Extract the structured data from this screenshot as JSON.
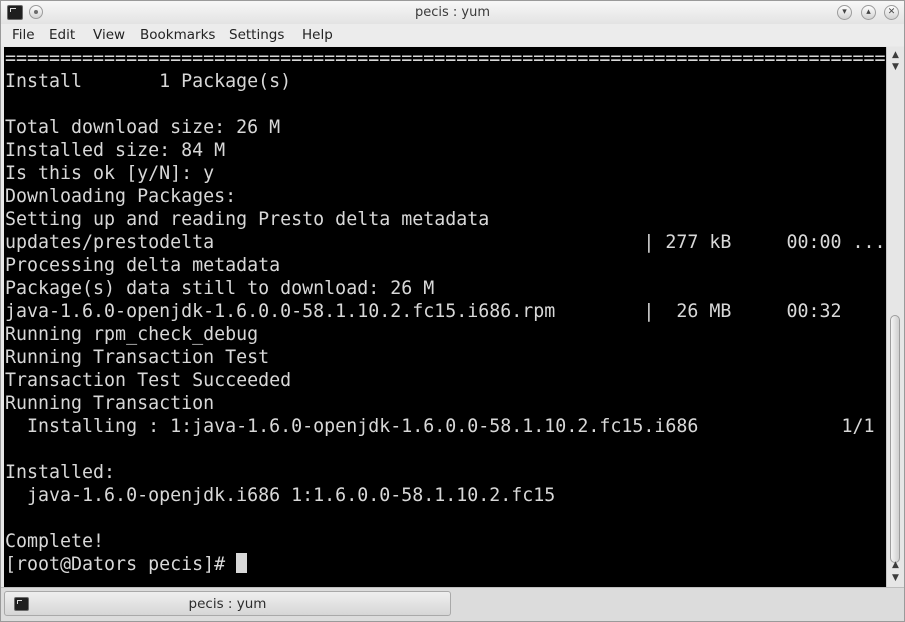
{
  "window": {
    "title": "pecis : yum"
  },
  "titlebar_buttons": {
    "minimize_glyph": "▾",
    "maximize_glyph": "▴",
    "close_glyph": "✕"
  },
  "menu": [
    "File",
    "Edit",
    "View",
    "Bookmarks",
    "Settings",
    "Help"
  ],
  "terminal": {
    "lines": [
      "================================================================================",
      "Install       1 Package(s)",
      "",
      "Total download size: 26 M",
      "Installed size: 84 M",
      "Is this ok [y/N]: y",
      "Downloading Packages:",
      "Setting up and reading Presto delta metadata",
      "updates/prestodelta                                       | 277 kB     00:00 ...",
      "Processing delta metadata",
      "Package(s) data still to download: 26 M",
      "java-1.6.0-openjdk-1.6.0.0-58.1.10.2.fc15.i686.rpm        |  26 MB     00:32",
      "Running rpm_check_debug",
      "Running Transaction Test",
      "Transaction Test Succeeded",
      "Running Transaction",
      "  Installing : 1:java-1.6.0-openjdk-1.6.0.0-58.1.10.2.fc15.i686             1/1",
      "",
      "Installed:",
      "  java-1.6.0-openjdk.i686 1:1.6.0.0-58.1.10.2.fc15",
      "",
      "Complete!"
    ],
    "prompt": "[root@Dators pecis]# "
  },
  "scrollbar": {
    "up_glyph": "▲",
    "down_glyph": "▼",
    "position_fraction": 1.0,
    "visible_fraction": 0.51
  },
  "tabs": [
    {
      "label": "pecis : yum",
      "active": true
    }
  ]
}
